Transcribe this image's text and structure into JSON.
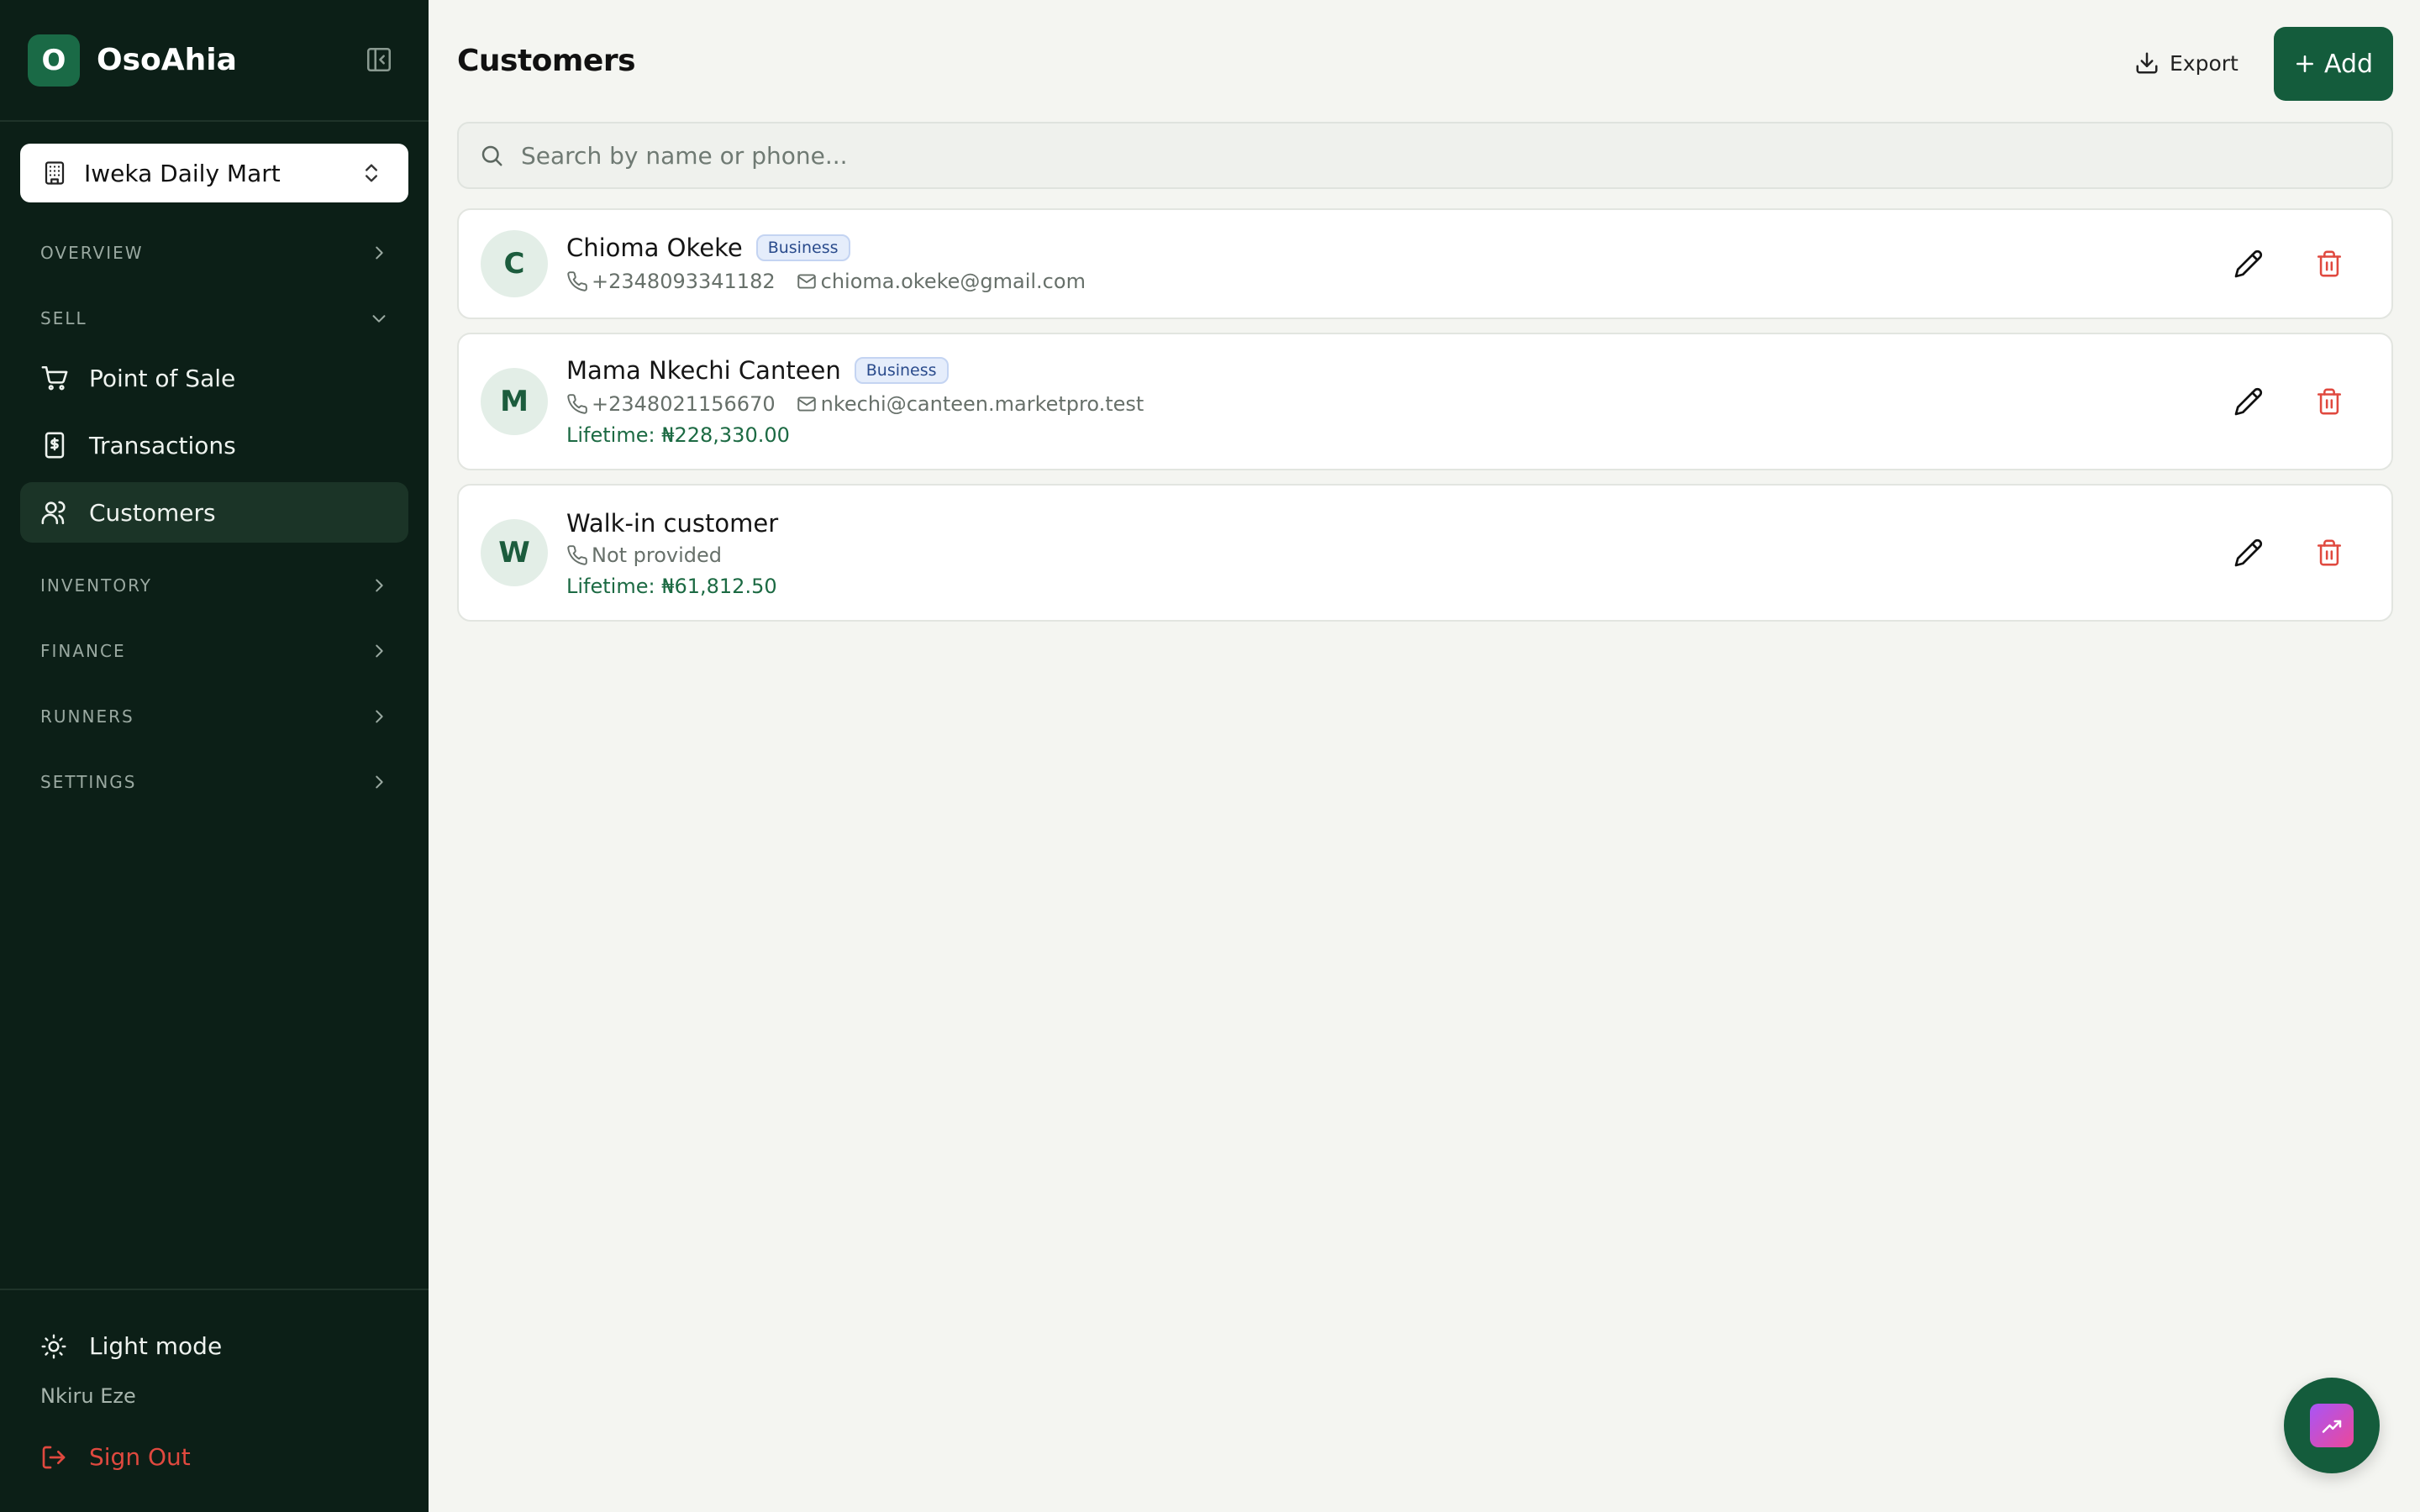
{
  "app": {
    "logo_letter": "O",
    "name": "OsoAhia"
  },
  "store": {
    "name": "Iweka Daily Mart"
  },
  "nav": {
    "overview": "OVERVIEW",
    "sell": "SELL",
    "sell_items": [
      {
        "label": "Point of Sale",
        "icon": "cart-icon"
      },
      {
        "label": "Transactions",
        "icon": "receipt-icon"
      },
      {
        "label": "Customers",
        "icon": "users-icon",
        "active": true
      }
    ],
    "inventory": "INVENTORY",
    "finance": "FINANCE",
    "runners": "RUNNERS",
    "settings": "SETTINGS"
  },
  "footer": {
    "theme_toggle": "Light mode",
    "user": "Nkiru Eze",
    "sign_out": "Sign Out"
  },
  "header": {
    "title": "Customers",
    "export_label": "Export",
    "add_label": "Add"
  },
  "search": {
    "placeholder": "Search by name or phone...",
    "value": ""
  },
  "customers": [
    {
      "initial": "C",
      "name": "Chioma Okeke",
      "badge": "Business",
      "phone": "+2348093341182",
      "email": "chioma.okeke@gmail.com"
    },
    {
      "initial": "M",
      "name": "Mama Nkechi Canteen",
      "badge": "Business",
      "phone": "+2348021156670",
      "email": "nkechi@canteen.marketpro.test",
      "lifetime": "Lifetime: ₦228,330.00"
    },
    {
      "initial": "W",
      "name": "Walk-in customer",
      "phone": "Not provided",
      "lifetime": "Lifetime: ₦61,812.50"
    }
  ],
  "colors": {
    "sidebar_bg": "#0c1f17",
    "accent": "#145c3c",
    "danger": "#e0493f",
    "page_bg": "#f4f5f1"
  }
}
